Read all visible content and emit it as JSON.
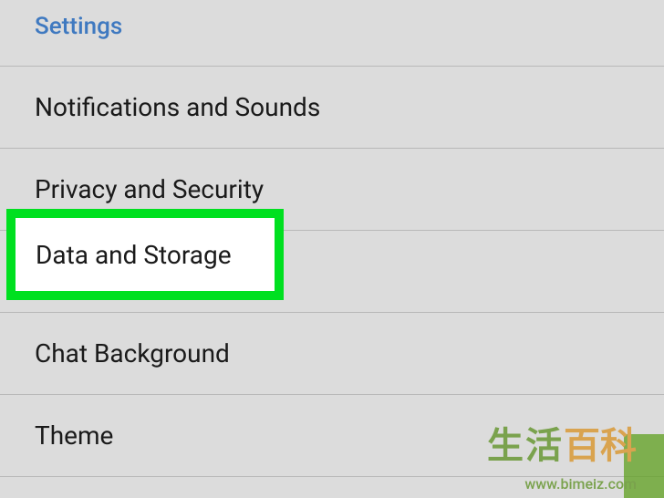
{
  "section": {
    "header": "Settings"
  },
  "items": [
    {
      "label": "Notifications and Sounds",
      "value": ""
    },
    {
      "label": "Privacy and Security",
      "value": ""
    },
    {
      "label": "Data and Storage",
      "value": ""
    },
    {
      "label": "Chat Background",
      "value": ""
    },
    {
      "label": "Theme",
      "value": ""
    }
  ],
  "highlight": {
    "label": "Data and Storage"
  },
  "watermark": {
    "text_cn_1": "生活",
    "text_cn_2": "百科",
    "url": "www.bimeiz.com"
  }
}
